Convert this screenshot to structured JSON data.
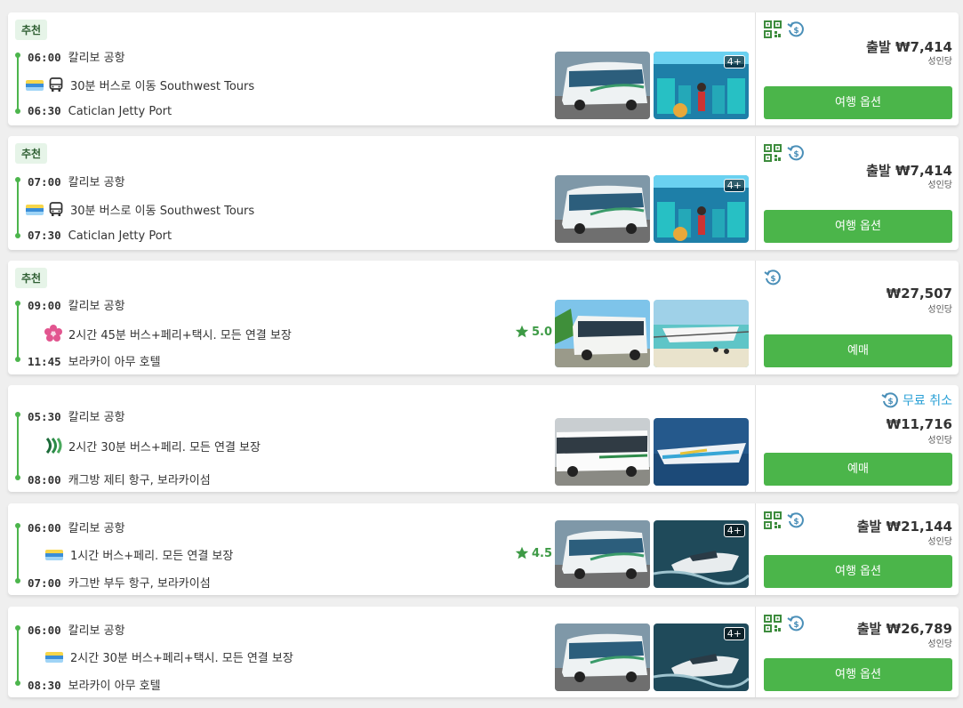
{
  "cards": [
    {
      "badge": "추천",
      "dep_time": "06:00",
      "dep_place": "칼리보 공항",
      "mid": "30분 버스로 이동 Southwest Tours",
      "arr_time": "06:30",
      "arr_place": "Caticlan Jetty Port",
      "more": "4+",
      "price": "출발 ₩7,414",
      "per": "성인당",
      "button": "여행 옵션"
    },
    {
      "badge": "추천",
      "dep_time": "07:00",
      "dep_place": "칼리보 공항",
      "mid": "30분 버스로 이동 Southwest Tours",
      "arr_time": "07:30",
      "arr_place": "Caticlan Jetty Port",
      "more": "4+",
      "price": "출발 ₩7,414",
      "per": "성인당",
      "button": "여행 옵션"
    },
    {
      "badge": "추천",
      "dep_time": "09:00",
      "dep_place": "칼리보 공항",
      "mid": "2시간 45분 버스+페리+택시. 모든 연결 보장",
      "rating": "5.0",
      "arr_time": "11:45",
      "arr_place": "보라카이 아무 호텔",
      "price": "₩27,507",
      "per": "성인당",
      "button": "예매"
    },
    {
      "dep_time": "05:30",
      "dep_place": "칼리보 공항",
      "mid": "2시간 30분 버스+페리. 모든 연결 보장",
      "arr_time": "08:00",
      "arr_place": "캐그방 제티 항구, 보라카이섬",
      "free_cancel": "무료 취소",
      "price": "₩11,716",
      "per": "성인당",
      "button": "예매"
    },
    {
      "dep_time": "06:00",
      "dep_place": "칼리보 공항",
      "mid": "1시간 버스+페리. 모든 연결 보장",
      "rating": "4.5",
      "arr_time": "07:00",
      "arr_place": "카그반 부두 항구, 보라카이섬",
      "more": "4+",
      "price": "출발 ₩21,144",
      "per": "성인당",
      "button": "여행 옵션"
    },
    {
      "dep_time": "06:00",
      "dep_place": "칼리보 공항",
      "mid": "2시간 30분 버스+페리+택시. 모든 연결 보장",
      "arr_time": "08:30",
      "arr_place": "보라카이 아무 호텔",
      "more": "4+",
      "price": "출발 ₩26,789",
      "per": "성인당",
      "button": "여행 옵션"
    }
  ],
  "colors": {
    "accent": "#4bb54a",
    "timeline": "#4cb54c",
    "free_cancel": "#2aa0d6",
    "qr_icon": "#3d8c3d",
    "refund_icon": "#4a8fb8"
  },
  "icons": [
    "qr-code-icon",
    "refund-clock-icon",
    "bus-icon",
    "star-icon",
    "operator-logo"
  ]
}
